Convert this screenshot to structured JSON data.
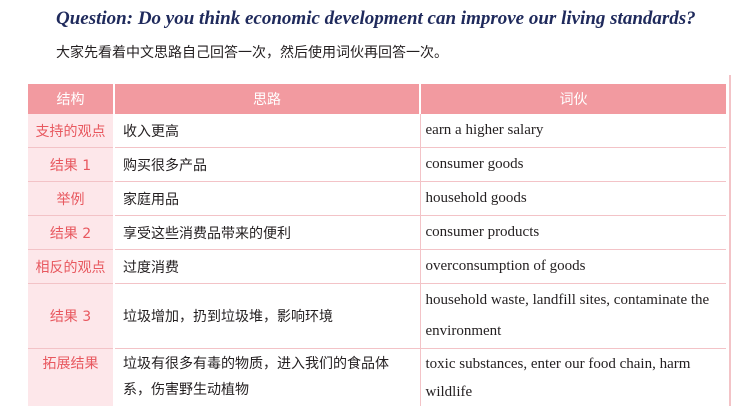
{
  "question": "Question: Do you think economic development can improve our living standards?",
  "instruction": "大家先看着中文思路自己回答一次，然后使用词伙再回答一次。",
  "table": {
    "headers": {
      "structure": "结构",
      "idea": "思路",
      "chunks": "词伙"
    },
    "rows": [
      {
        "structure": "支持的观点",
        "idea": "收入更高",
        "chunks": "earn a higher salary"
      },
      {
        "structure": "结果 1",
        "idea": "购买很多产品",
        "chunks": "consumer goods"
      },
      {
        "structure": "举例",
        "idea": "家庭用品",
        "chunks": "household goods"
      },
      {
        "structure": "结果 2",
        "idea": "享受这些消费品带来的便利",
        "chunks": "consumer products"
      },
      {
        "structure": "相反的观点",
        "idea": "过度消费",
        "chunks": "overconsumption of goods"
      },
      {
        "structure": "结果 3",
        "idea": "垃圾增加，扔到垃圾堆，影响环境",
        "chunks": "household waste, landfill sites, contaminate the environment"
      },
      {
        "structure": "拓展结果",
        "idea": "垃圾有很多有毒的物质，进入我们的食品体系，伤害野生动植物",
        "chunks": "toxic substances, enter our food chain, harm wildlife"
      }
    ]
  },
  "colors": {
    "header_bg": "#f29aa0",
    "structure_bg": "#fde7ea",
    "structure_text": "#e8585f",
    "question_text": "#1f2a5c"
  }
}
